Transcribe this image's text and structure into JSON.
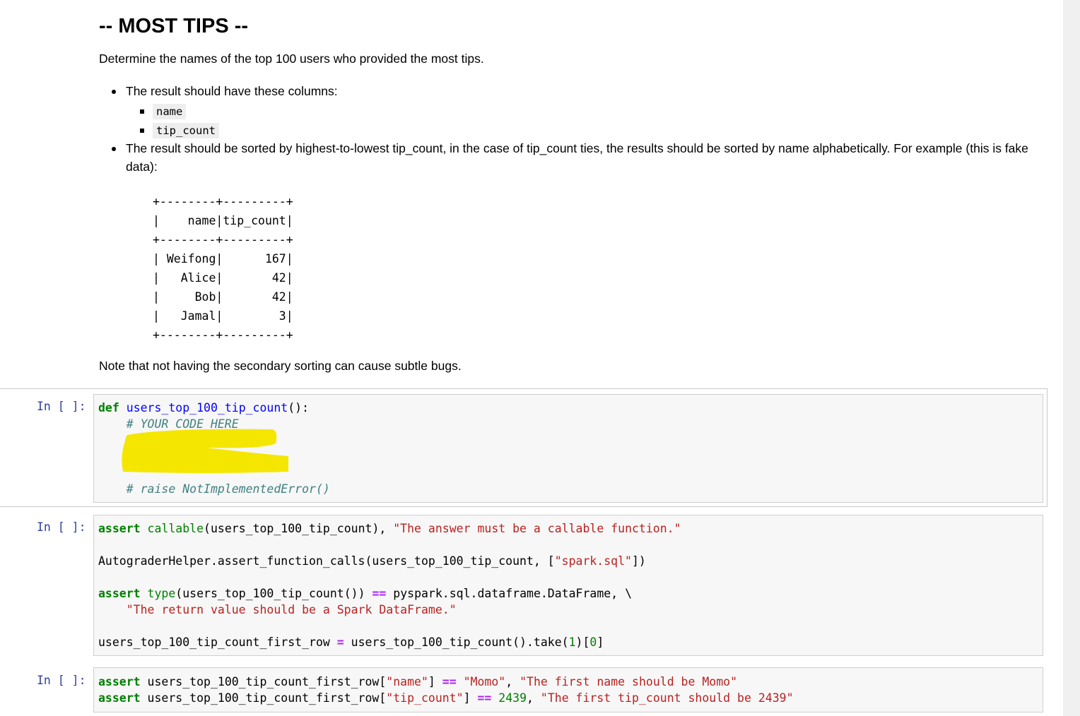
{
  "markdown": {
    "heading": "-- MOST TIPS --",
    "intro": "Determine the names of the top 100 users who provided the most tips.",
    "bullet_columns": "The result should have these columns:",
    "columns": [
      "name",
      "tip_count"
    ],
    "bullet_sort": "The result should be sorted by highest-to-lowest tip_count, in the case of tip_count ties, the results should be sorted by name alphabetically. For example (this is fake data):",
    "example_table": "+--------+---------+\n|    name|tip_count|\n+--------+---------+\n| Weifong|      167|\n|   Alice|       42|\n|     Bob|       42|\n|   Jamal|        3|\n+--------+---------+",
    "note": "Note that not having the secondary sorting can cause subtle bugs."
  },
  "cells": [
    {
      "prompt": "In [ ]:",
      "def_kw": "def",
      "func_name": "users_top_100_tip_count",
      "def_tail": "():",
      "comment_code_here": "    # YOUR CODE HERE",
      "comment_raise": "    # raise NotImplementedError()"
    },
    {
      "prompt": "In [ ]:",
      "assert_kw": "assert",
      "callable_bi": "callable",
      "line1_mid": "(users_top_100_tip_count), ",
      "line1_str": "\"The answer must be a callable function.\"",
      "line2_a": "AutograderHelper.assert_function_calls(users_top_100_tip_count, [",
      "line2_str": "\"spark.sql\"",
      "line2_b": "])",
      "type_bi": "type",
      "line3_mid": "(users_top_100_tip_count()) ",
      "eq_op": "==",
      "line3_tail": " pyspark.sql.dataframe.DataFrame, \\",
      "line4_str": "    \"The return value should be a Spark DataFrame.\"",
      "line5_a": "users_top_100_tip_count_first_row ",
      "assign_op": "=",
      "line5_b": " users_top_100_tip_count().take(",
      "num_one": "1",
      "line5_c": ")[",
      "num_zero": "0",
      "line5_d": "]"
    },
    {
      "prompt": "In [ ]:",
      "assert_kw": "assert",
      "l1_a": " users_top_100_tip_count_first_row[",
      "l1_key": "\"name\"",
      "l1_b": "] ",
      "eq_op": "==",
      "l1_val": "\"Momo\"",
      "l1_c": ", ",
      "l1_msg": "\"The first name should be Momo\"",
      "l2_key": "\"tip_count\"",
      "l2_num": "2439",
      "l2_msg": "\"The first tip_count should be 2439\""
    }
  ],
  "colors": {
    "prompt": "#303f9f",
    "keyword": "#008000",
    "string": "#ba2121",
    "comment": "#408080",
    "operator": "#aa22ff",
    "redaction": "#f5e600"
  }
}
